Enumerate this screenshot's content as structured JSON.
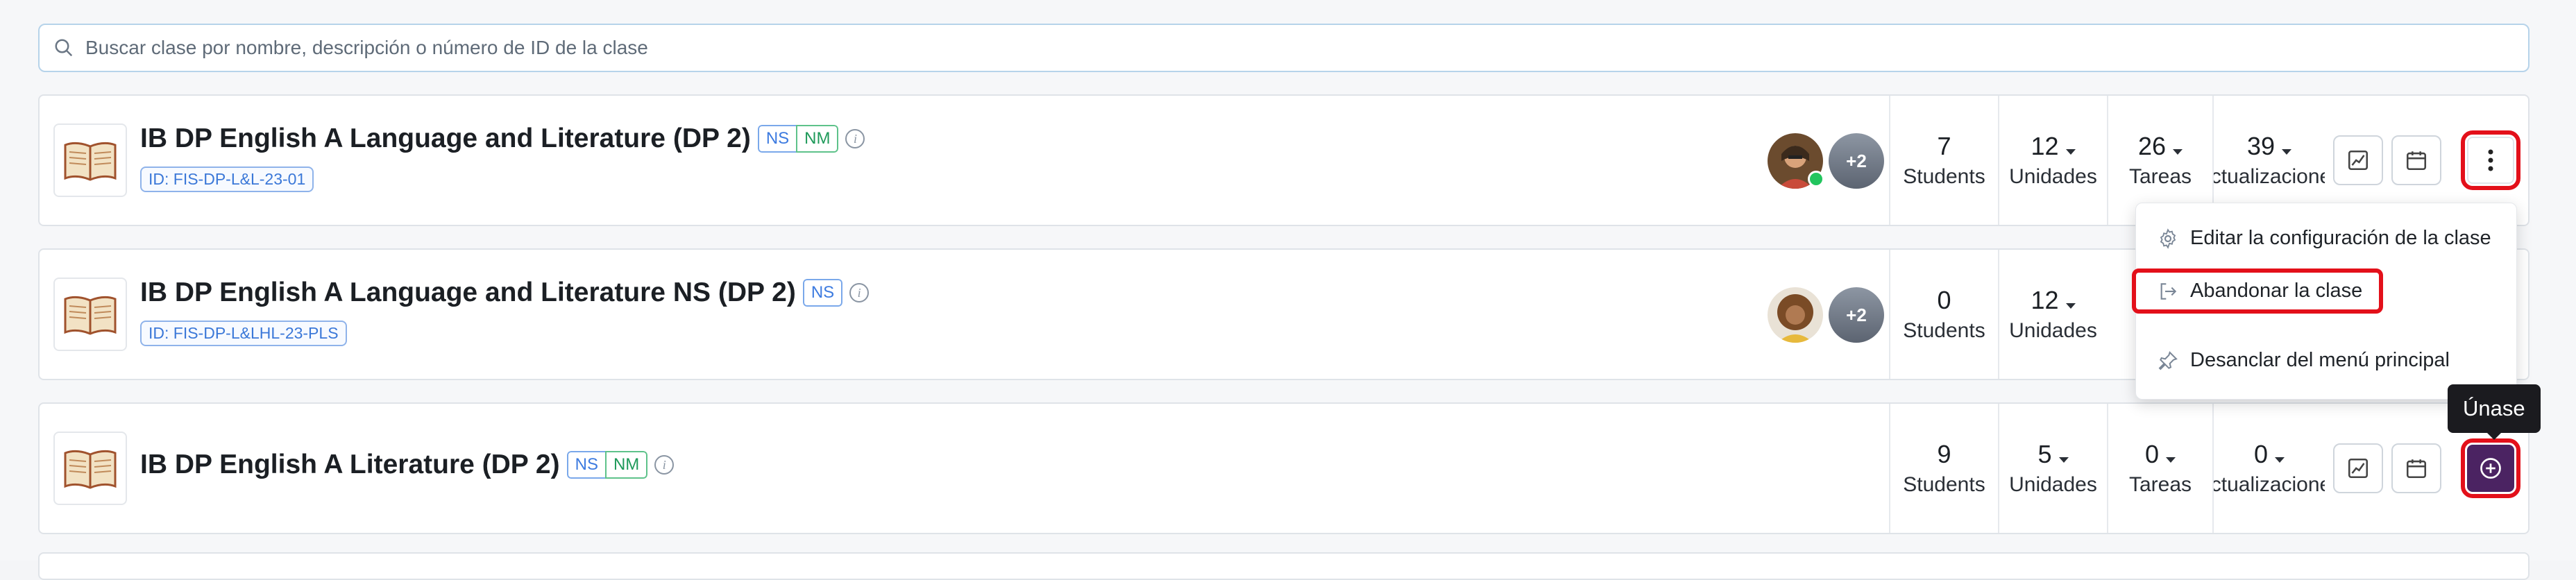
{
  "search": {
    "placeholder": "Buscar clase por nombre, descripción o número de ID de la clase"
  },
  "classes": [
    {
      "title": "IB DP English A Language and Literature (DP 2)",
      "tags": [
        "NS",
        "NM"
      ],
      "id_label": "ID: FIS-DP-L&L-23-01",
      "more_count": "+2",
      "stats": [
        {
          "value": "7",
          "label": "Students"
        },
        {
          "value": "12",
          "label": "Unidades"
        },
        {
          "value": "26",
          "label": "Tareas"
        },
        {
          "value": "39",
          "label": "Actualizaciones"
        }
      ]
    },
    {
      "title": "IB DP English A Language and Literature NS (DP 2)",
      "tags": [
        "NS"
      ],
      "id_label": "ID: FIS-DP-L&LHL-23-PLS",
      "more_count": "+2",
      "stats": [
        {
          "value": "0",
          "label": "Students"
        },
        {
          "value": "12",
          "label": "Unidades"
        }
      ]
    },
    {
      "title": "IB DP English A Literature (DP 2)",
      "tags": [
        "NS",
        "NM"
      ],
      "stats": [
        {
          "value": "9",
          "label": "Students"
        },
        {
          "value": "5",
          "label": "Unidades"
        },
        {
          "value": "0",
          "label": "Tareas"
        },
        {
          "value": "0",
          "label": "Actualizaciones"
        }
      ]
    }
  ],
  "menu": {
    "items": [
      {
        "label": "Editar la configuración de la clase",
        "icon": "gear-icon"
      },
      {
        "label": "Abandonar la clase",
        "icon": "leave-icon"
      },
      {
        "label": "Desanclar del menú principal",
        "icon": "unpin-icon"
      }
    ]
  },
  "tooltip": "Únase",
  "colors": {
    "join_button": "#4b2362",
    "highlight": "#e3101a",
    "ns_tag": "#3d7be0",
    "nm_tag": "#1f9a5a"
  }
}
